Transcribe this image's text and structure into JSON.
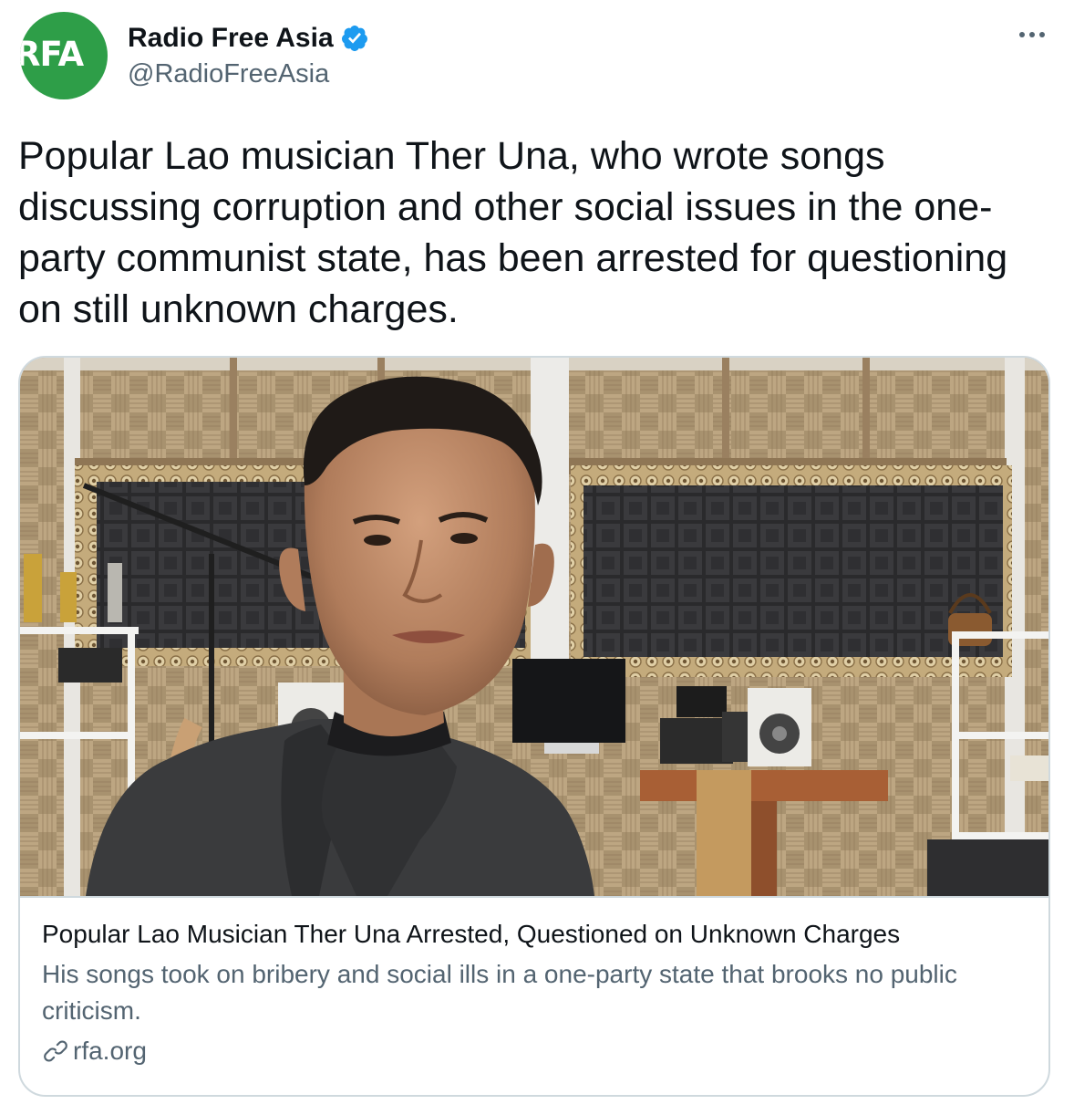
{
  "author": {
    "avatar_text": "RFA",
    "display_name": "Radio Free Asia",
    "handle": "@RadioFreeAsia",
    "verified": true,
    "avatar_color": "#2e9e48",
    "verified_color": "#1d9bf0"
  },
  "menu": {
    "icon": "more-dots-icon"
  },
  "tweet": {
    "text": "Popular Lao musician Ther Una, who wrote songs discussing corruption and other social issues in the one-party communist state, has been arrested for questioning on still unknown charges."
  },
  "link_card": {
    "image_alt": "Man in a dark shirt seated in a home recording studio with woven bamboo walls and acoustic foam panels",
    "title": "Popular Lao Musician Ther Una Arrested, Questioned on Unknown Charges",
    "description": "His songs took on bribery and social ills in a one-party state that brooks no public criticism.",
    "domain": "rfa.org",
    "domain_icon": "link-icon"
  },
  "colors": {
    "text_primary": "#0f1419",
    "text_secondary": "#536471",
    "border": "#cfd9de"
  }
}
